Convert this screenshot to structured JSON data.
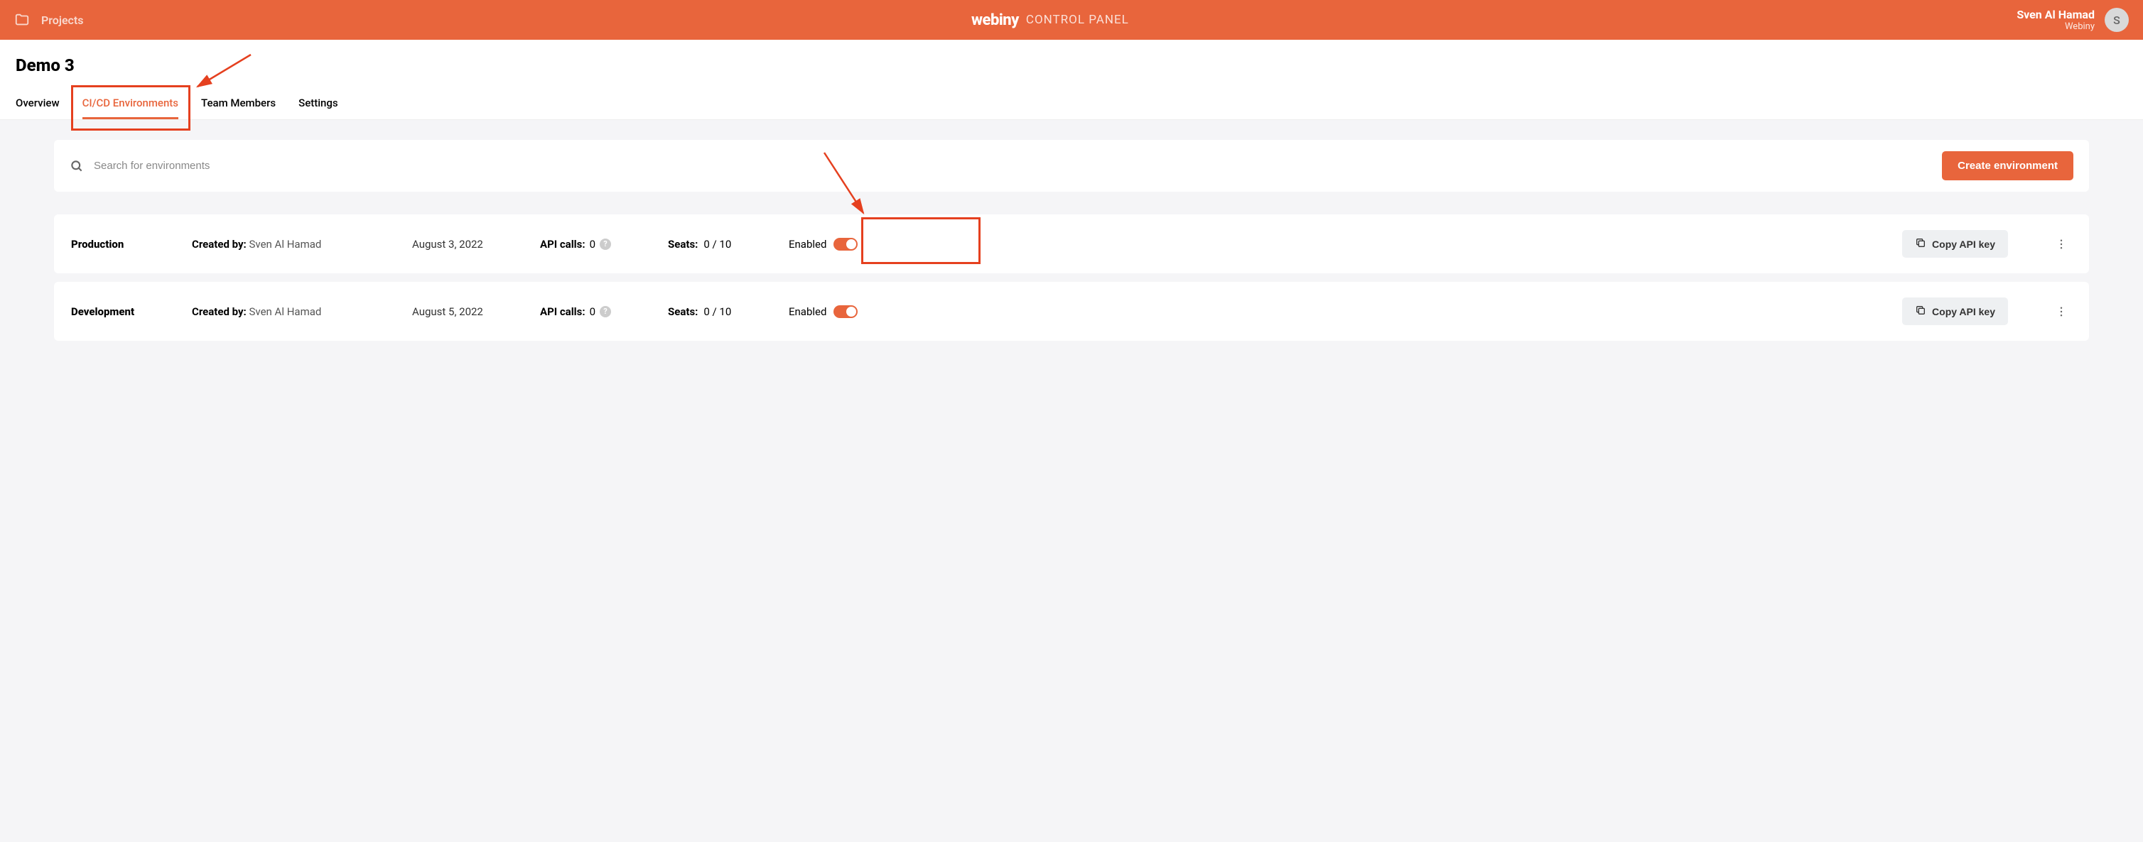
{
  "header": {
    "projects_label": "Projects",
    "logo": "webiny",
    "control_panel": "CONTROL PANEL",
    "user_name": "Sven Al Hamad",
    "user_org": "Webiny",
    "avatar_initial": "S"
  },
  "page": {
    "title": "Demo 3",
    "tabs": [
      {
        "label": "Overview",
        "active": false
      },
      {
        "label": "CI/CD Environments",
        "active": true
      },
      {
        "label": "Team Members",
        "active": false
      },
      {
        "label": "Settings",
        "active": false
      }
    ]
  },
  "search": {
    "placeholder": "Search for environments",
    "create_label": "Create environment"
  },
  "labels": {
    "created_by": "Created by:",
    "api_calls": "API calls:",
    "seats": "Seats:",
    "enabled": "Enabled",
    "copy_api_key": "Copy API key"
  },
  "environments": [
    {
      "name": "Production",
      "created_by": "Sven Al Hamad",
      "date": "August 3, 2022",
      "api_calls": "0",
      "seats": "0 / 10",
      "enabled": true
    },
    {
      "name": "Development",
      "created_by": "Sven Al Hamad",
      "date": "August 5, 2022",
      "api_calls": "0",
      "seats": "0 / 10",
      "enabled": true
    }
  ]
}
